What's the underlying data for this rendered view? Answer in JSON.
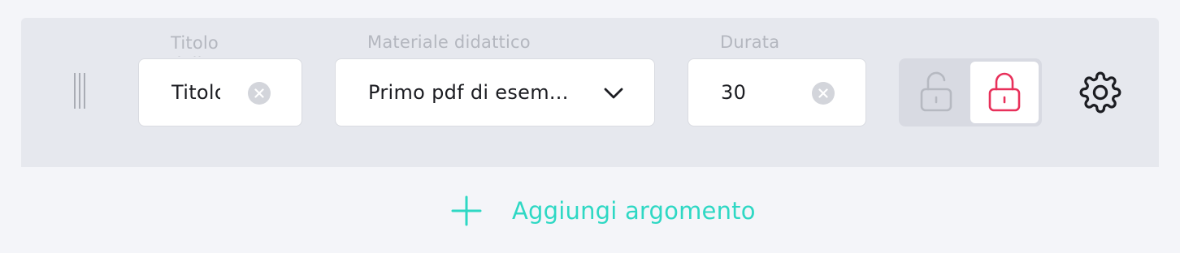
{
  "topic_row": {
    "title_field": {
      "label": "Titolo dell'argomento",
      "value": "Titolo"
    },
    "material_field": {
      "label": "Materiale didattico",
      "value": "Primo pdf di esem..."
    },
    "duration_field": {
      "label": "Durata",
      "value": "30"
    },
    "lock_toggle": {
      "selected": "locked",
      "accent_color": "#e8305a",
      "inactive_color": "#b6b9c1"
    },
    "icons": {
      "drag": "drag-handle-icon",
      "clear": "clear-icon",
      "dropdown": "chevron-down-icon",
      "unlock": "unlock-icon",
      "lock": "lock-icon",
      "settings": "gear-icon"
    }
  },
  "add_topic": {
    "label": "Aggiungi argomento",
    "color": "#2ed8c4"
  }
}
